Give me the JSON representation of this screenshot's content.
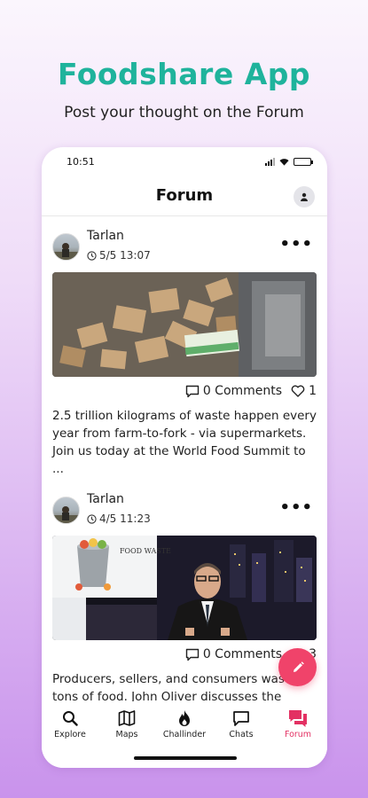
{
  "hero": {
    "title": "Foodshare App",
    "subtitle": "Post your thought on the Forum"
  },
  "status_bar": {
    "time": "10:51"
  },
  "app_bar": {
    "title": "Forum"
  },
  "posts": [
    {
      "author": "Tarlan",
      "timestamp": "5/5 13:07",
      "comments": "0 Comments",
      "likes": "1",
      "text": "2.5 trillion kilograms of waste happen every year from farm-to-fork - via supermarkets. Join us today at the World Food Summit to ..."
    },
    {
      "author": "Tarlan",
      "timestamp": "4/5 11:23",
      "comments": "0 Comments",
      "likes": "3",
      "image_caption": "FOOD WASTE",
      "text": "Producers, sellers, and consumers waste tons of food. John Oliver discusses the"
    }
  ],
  "tabs": [
    {
      "label": "Explore",
      "icon": "search-icon"
    },
    {
      "label": "Maps",
      "icon": "map-icon"
    },
    {
      "label": "Challinder",
      "icon": "flame-icon"
    },
    {
      "label": "Chats",
      "icon": "chat-icon"
    },
    {
      "label": "Forum",
      "icon": "forum-icon",
      "active": true
    }
  ],
  "colors": {
    "accent": "#1fb39c",
    "active_tab": "#e33163",
    "fab": "#f0436a"
  }
}
